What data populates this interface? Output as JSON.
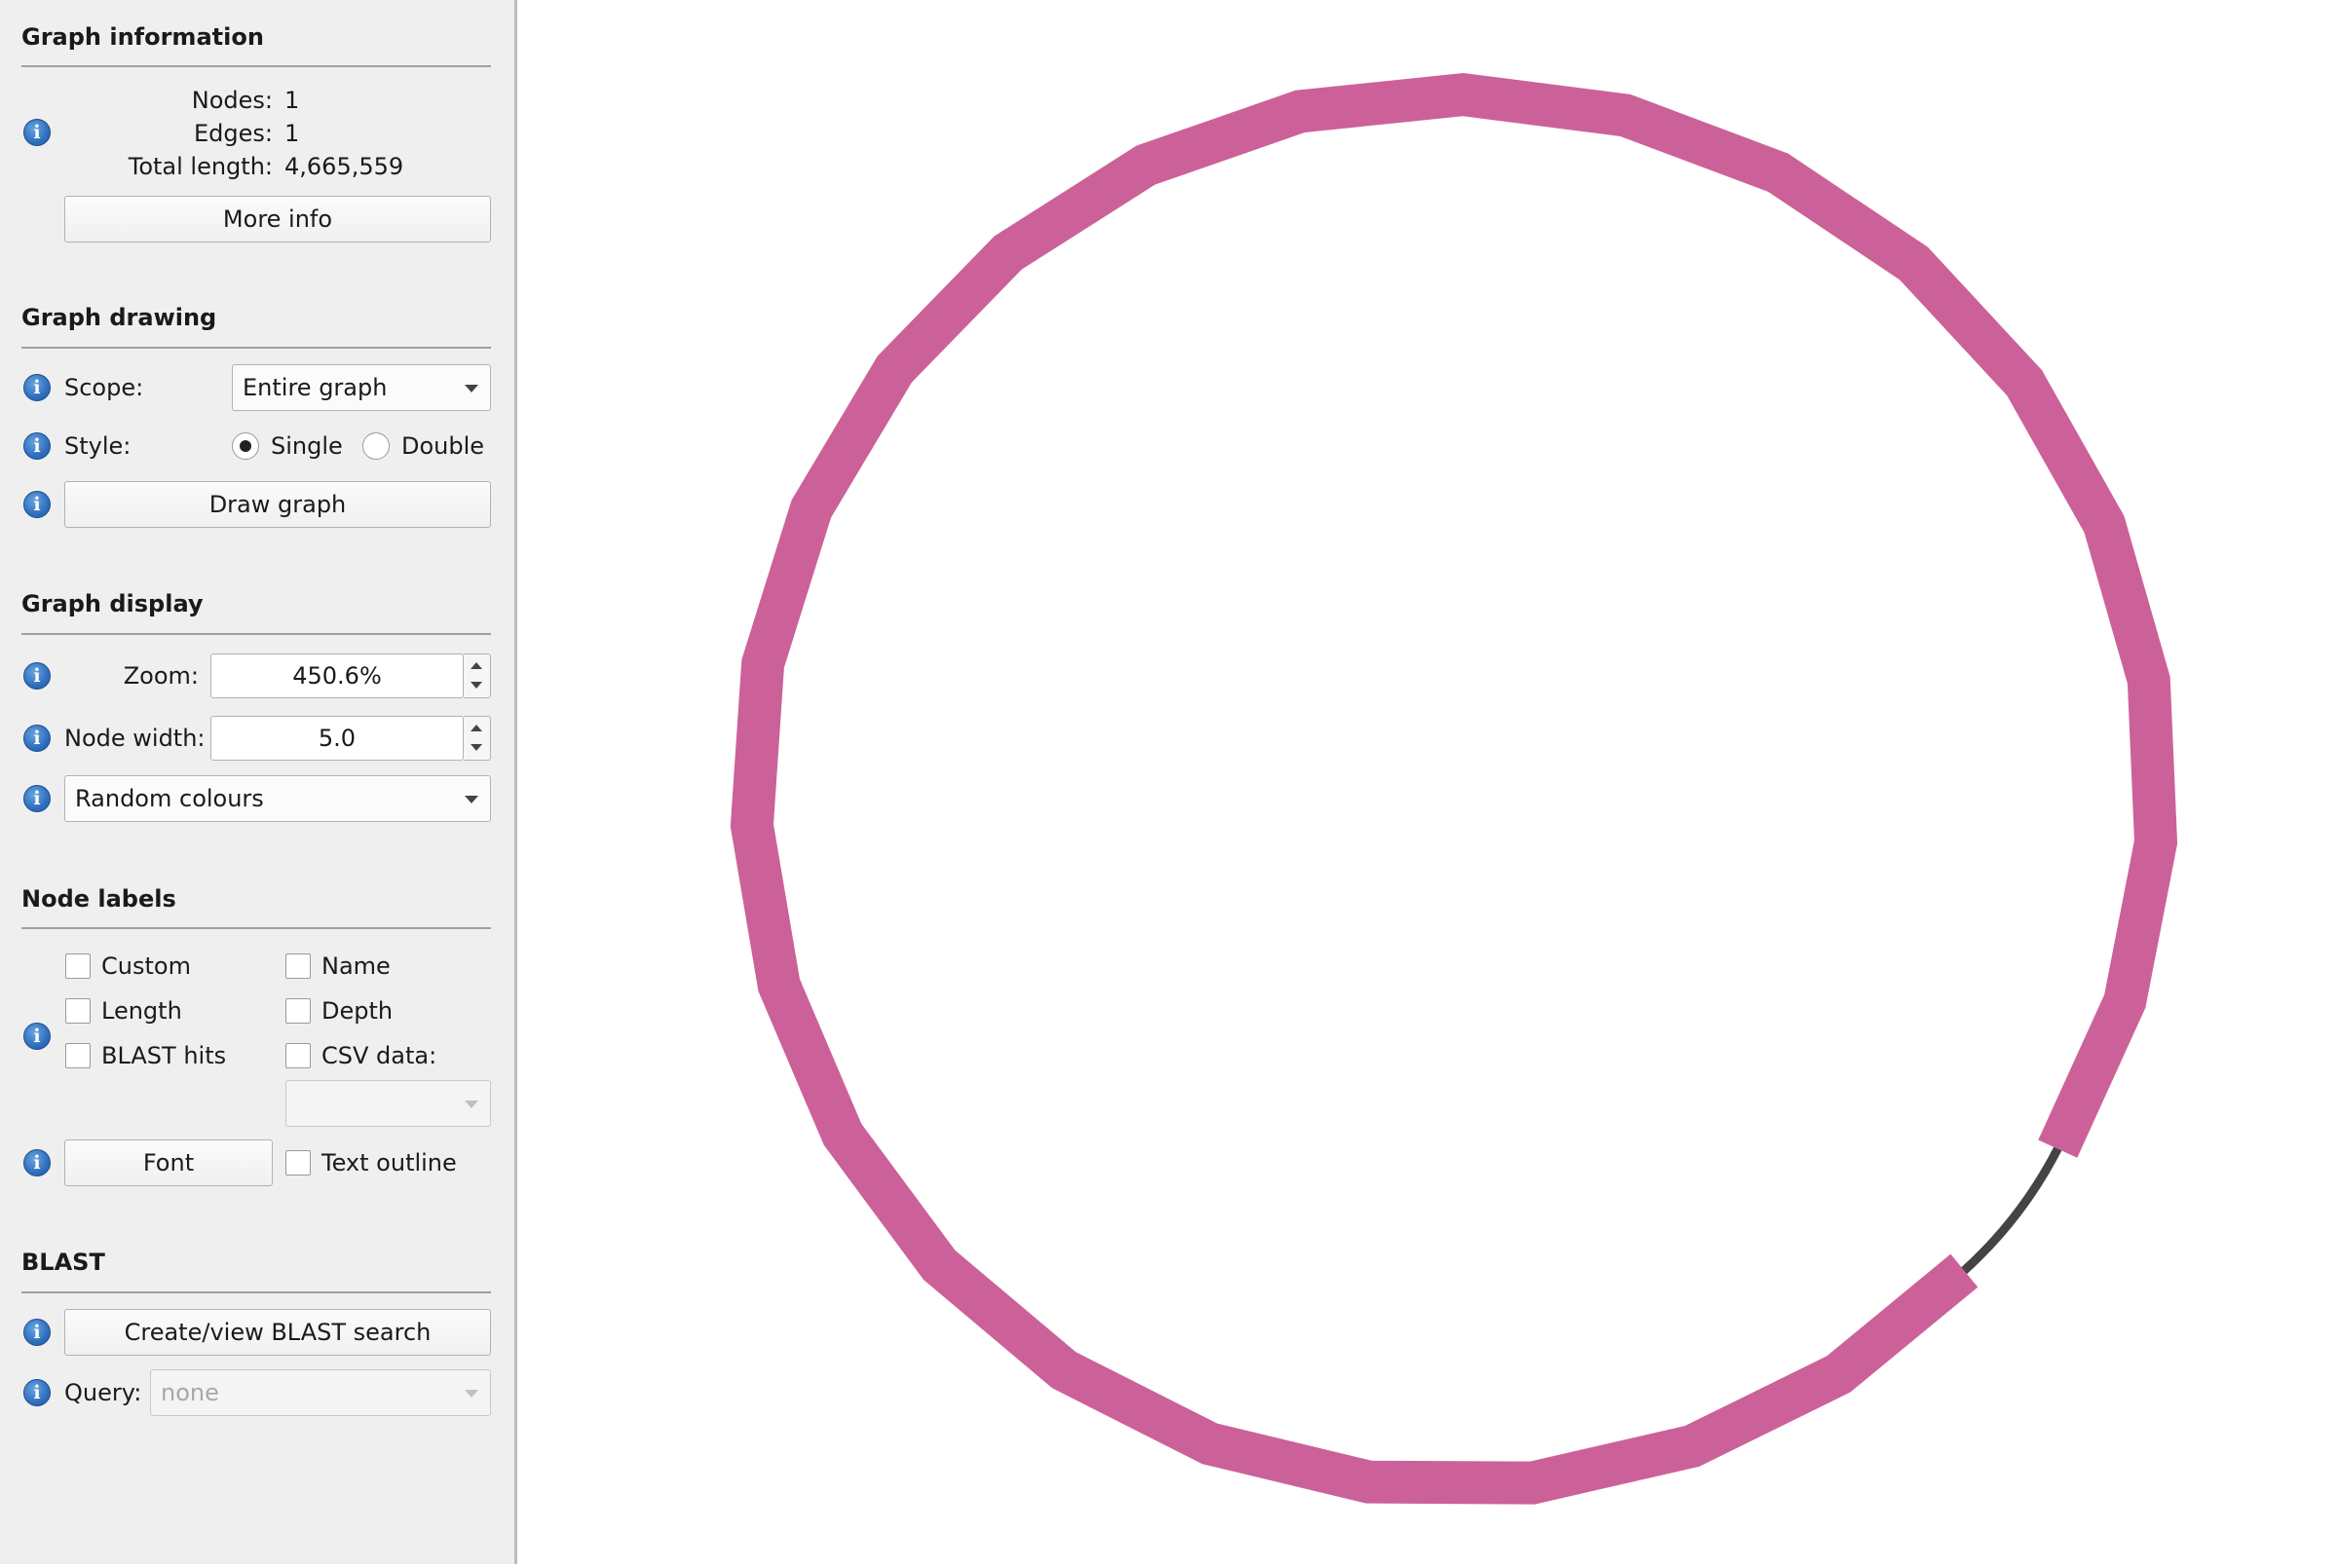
{
  "info": {
    "title": "Graph information",
    "nodes_label": "Nodes:",
    "nodes_value": "1",
    "edges_label": "Edges:",
    "edges_value": "1",
    "length_label": "Total length:",
    "length_value": "4,665,559",
    "more_info": "More info"
  },
  "drawing": {
    "title": "Graph drawing",
    "scope_label": "Scope:",
    "scope_value": "Entire graph",
    "style_label": "Style:",
    "style_single": "Single",
    "style_double": "Double",
    "style_selected": "Single",
    "draw_button": "Draw graph"
  },
  "display": {
    "title": "Graph display",
    "zoom_label": "Zoom:",
    "zoom_value": "450.6%",
    "node_width_label": "Node width:",
    "node_width_value": "5.0",
    "colour_scheme": "Random colours"
  },
  "labels": {
    "title": "Node labels",
    "custom": "Custom",
    "name": "Name",
    "length": "Length",
    "depth": "Depth",
    "blast_hits": "BLAST hits",
    "csv_data": "CSV data:",
    "csv_value": "",
    "font_button": "Font",
    "text_outline": "Text outline"
  },
  "blast": {
    "title": "BLAST",
    "search_button": "Create/view BLAST search",
    "query_label": "Query:",
    "query_value": "none"
  },
  "graph": {
    "node_color": "#cc6199",
    "edge_color": "#444444"
  }
}
